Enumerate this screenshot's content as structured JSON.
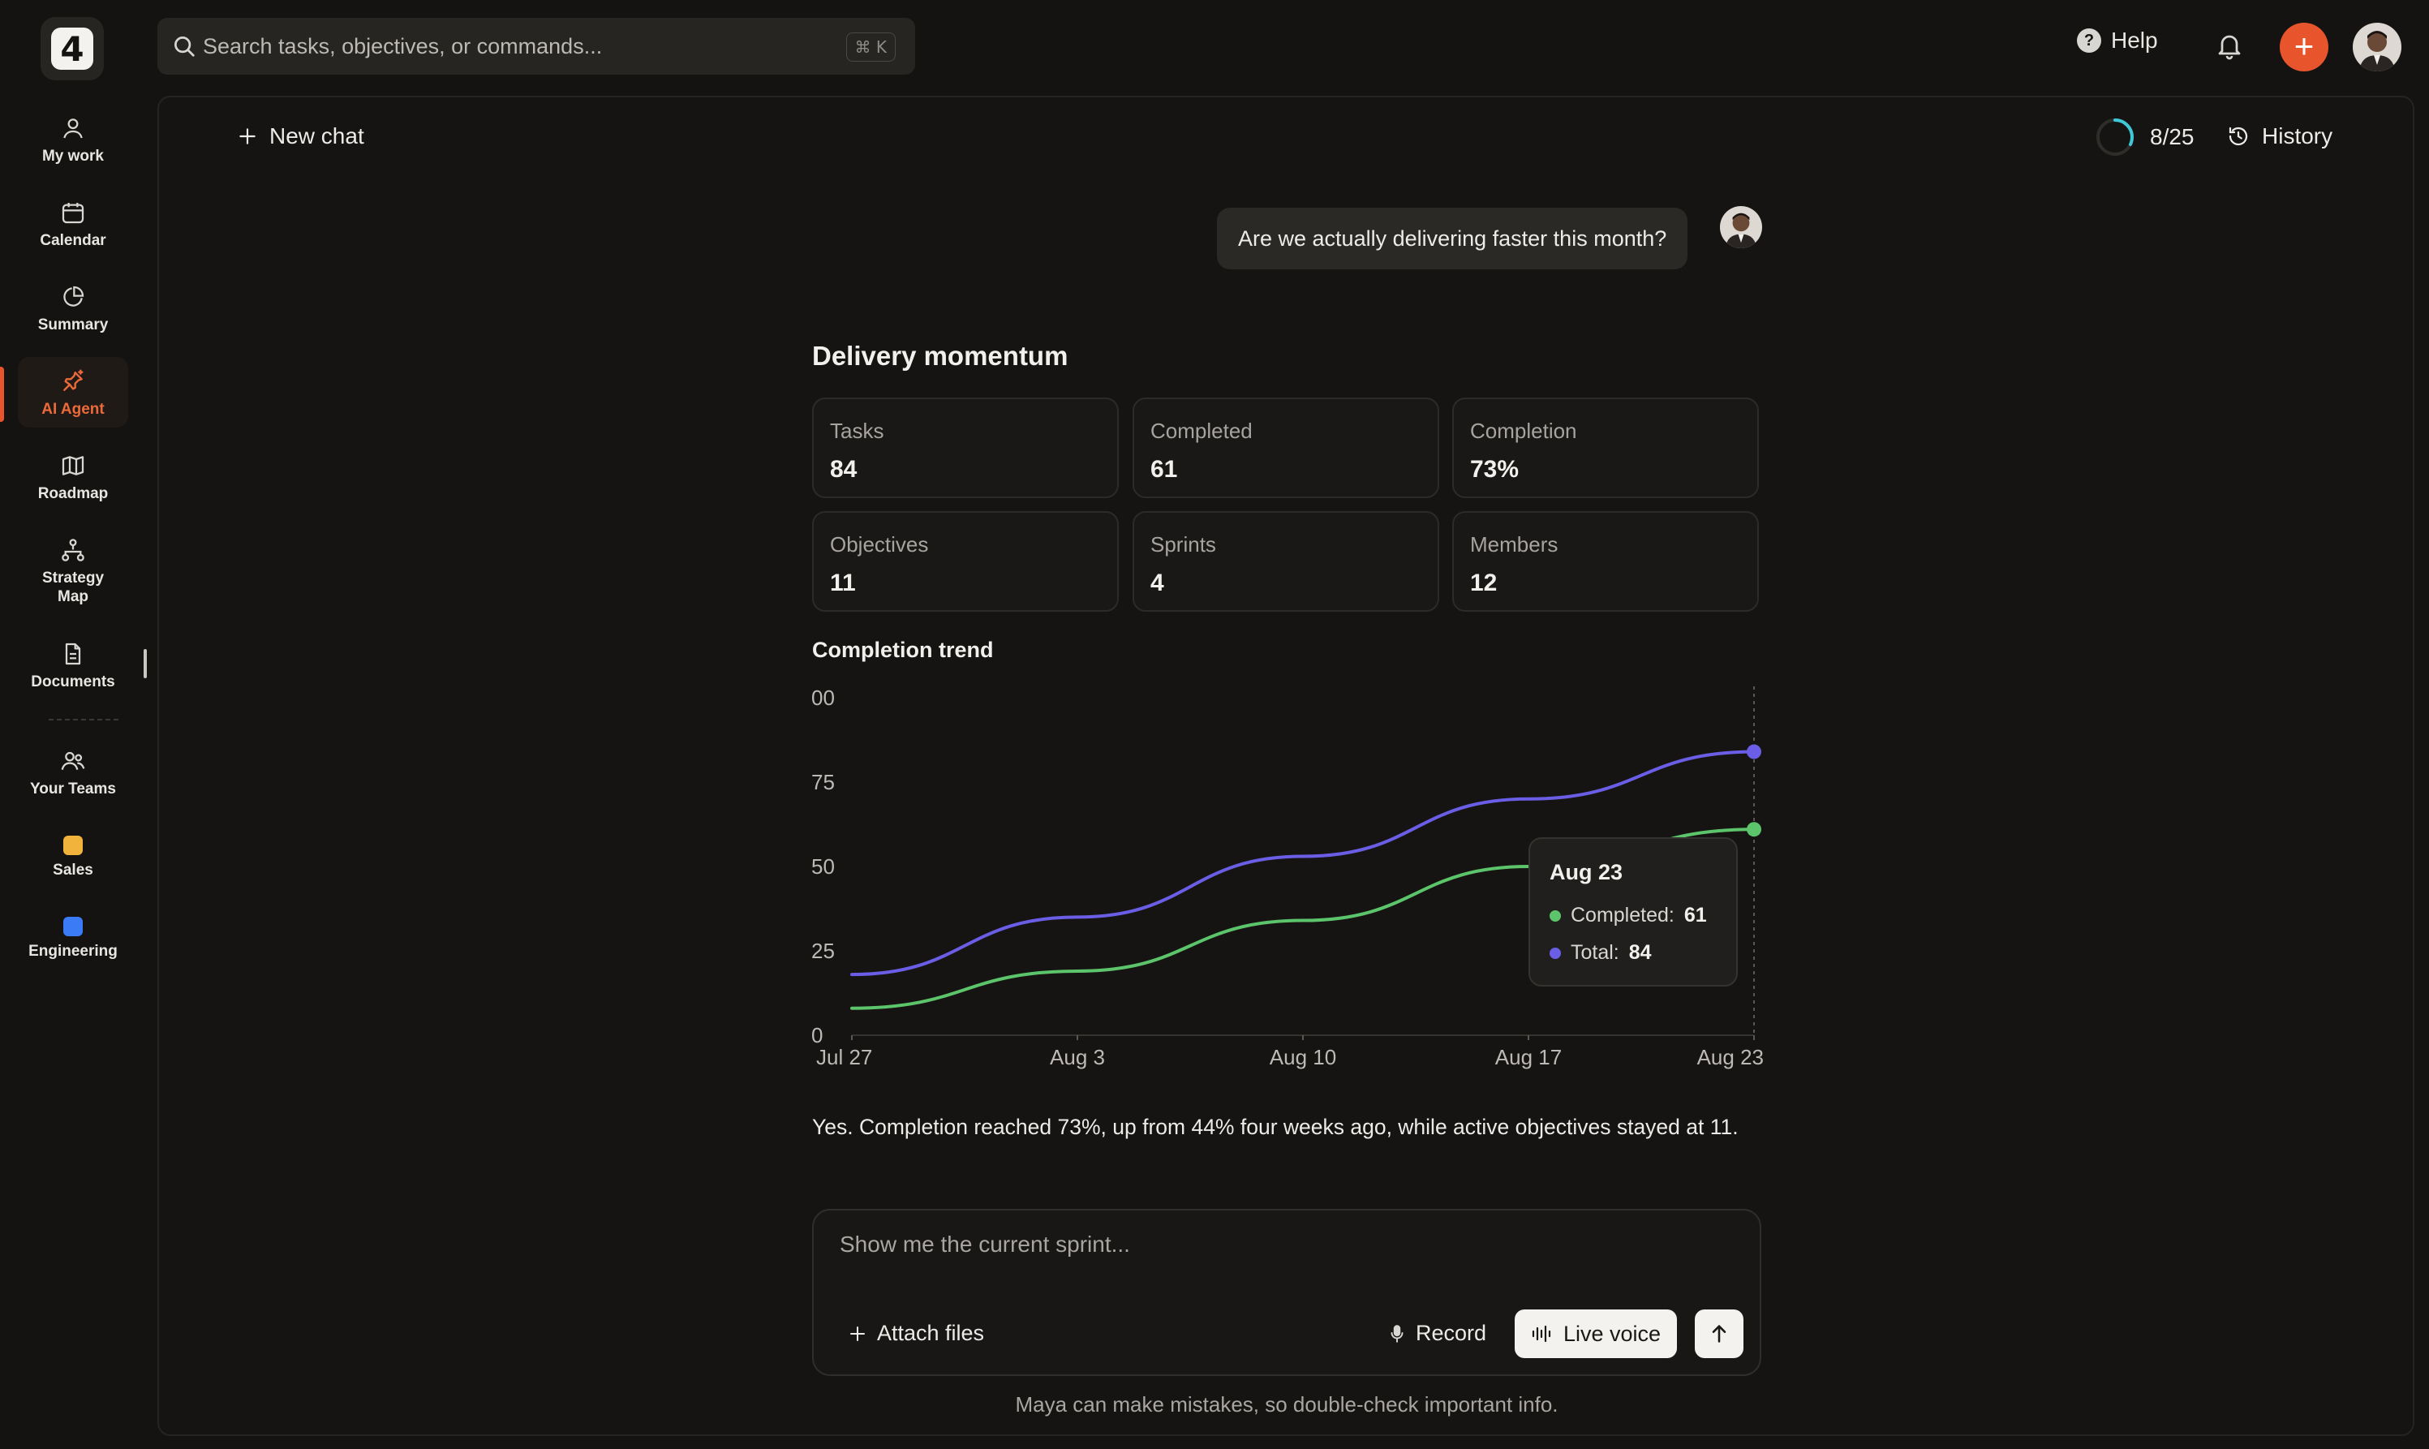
{
  "app": {
    "logo_text": "4"
  },
  "search": {
    "placeholder": "Search tasks, objectives, or commands...",
    "shortcut": "⌘ K"
  },
  "header": {
    "help_label": "Help"
  },
  "sidebar": {
    "items": [
      {
        "label": "My work",
        "icon": "person-icon"
      },
      {
        "label": "Calendar",
        "icon": "calendar-icon"
      },
      {
        "label": "Summary",
        "icon": "pie-chart-icon"
      },
      {
        "label": "AI Agent",
        "icon": "pin-sparkle-icon",
        "active": true
      },
      {
        "label": "Roadmap",
        "icon": "map-icon"
      },
      {
        "label": "Strategy Map",
        "icon": "hierarchy-icon"
      },
      {
        "label": "Documents",
        "icon": "document-icon"
      }
    ],
    "teams_label": "Your Teams",
    "teams": [
      {
        "label": "Sales",
        "color": "#f2b33d"
      },
      {
        "label": "Engineering",
        "color": "#3b7bf5"
      }
    ]
  },
  "chat": {
    "new_chat_label": "New chat",
    "usage": {
      "text": "8/25",
      "used": 8,
      "limit": 25
    },
    "history_label": "History",
    "user_message": "Are we actually delivering faster this month?",
    "section_title": "Delivery momentum",
    "stats": [
      {
        "label": "Tasks",
        "value": "84"
      },
      {
        "label": "Completed",
        "value": "61"
      },
      {
        "label": "Completion",
        "value": "73%"
      },
      {
        "label": "Objectives",
        "value": "11"
      },
      {
        "label": "Sprints",
        "value": "4"
      },
      {
        "label": "Members",
        "value": "12"
      }
    ],
    "trend_title": "Completion trend",
    "answer": "Yes. Completion reached 73%, up from 44% four weeks ago, while active objectives stayed at 11.",
    "tooltip": {
      "date": "Aug 23",
      "completed_label": "Completed:",
      "completed_value": "61",
      "total_label": "Total:",
      "total_value": "84"
    }
  },
  "composer": {
    "placeholder": "Show me the current sprint...",
    "attach_label": "Attach files",
    "record_label": "Record",
    "live_voice_label": "Live voice",
    "disclaimer": "Maya can make mistakes, so double-check important info."
  },
  "colors": {
    "accent": "#e8542b",
    "completed": "#5cc46a",
    "total": "#6b5ee6",
    "usage_ring": "#3ec8d8"
  },
  "chart_data": {
    "type": "line",
    "title": "Completion trend",
    "x": [
      "Jul 27",
      "Aug 3",
      "Aug 10",
      "Aug 17",
      "Aug 23"
    ],
    "y_ticks": [
      "0",
      "25",
      "50",
      "75",
      "00"
    ],
    "ylim": [
      0,
      100
    ],
    "grid": false,
    "series": [
      {
        "name": "Completed",
        "values": [
          8,
          19,
          34,
          50,
          61
        ],
        "color": "#5cc46a"
      },
      {
        "name": "Total",
        "values": [
          18,
          35,
          53,
          70,
          84
        ],
        "color": "#6b5ee6"
      }
    ],
    "highlight_index": 4
  }
}
